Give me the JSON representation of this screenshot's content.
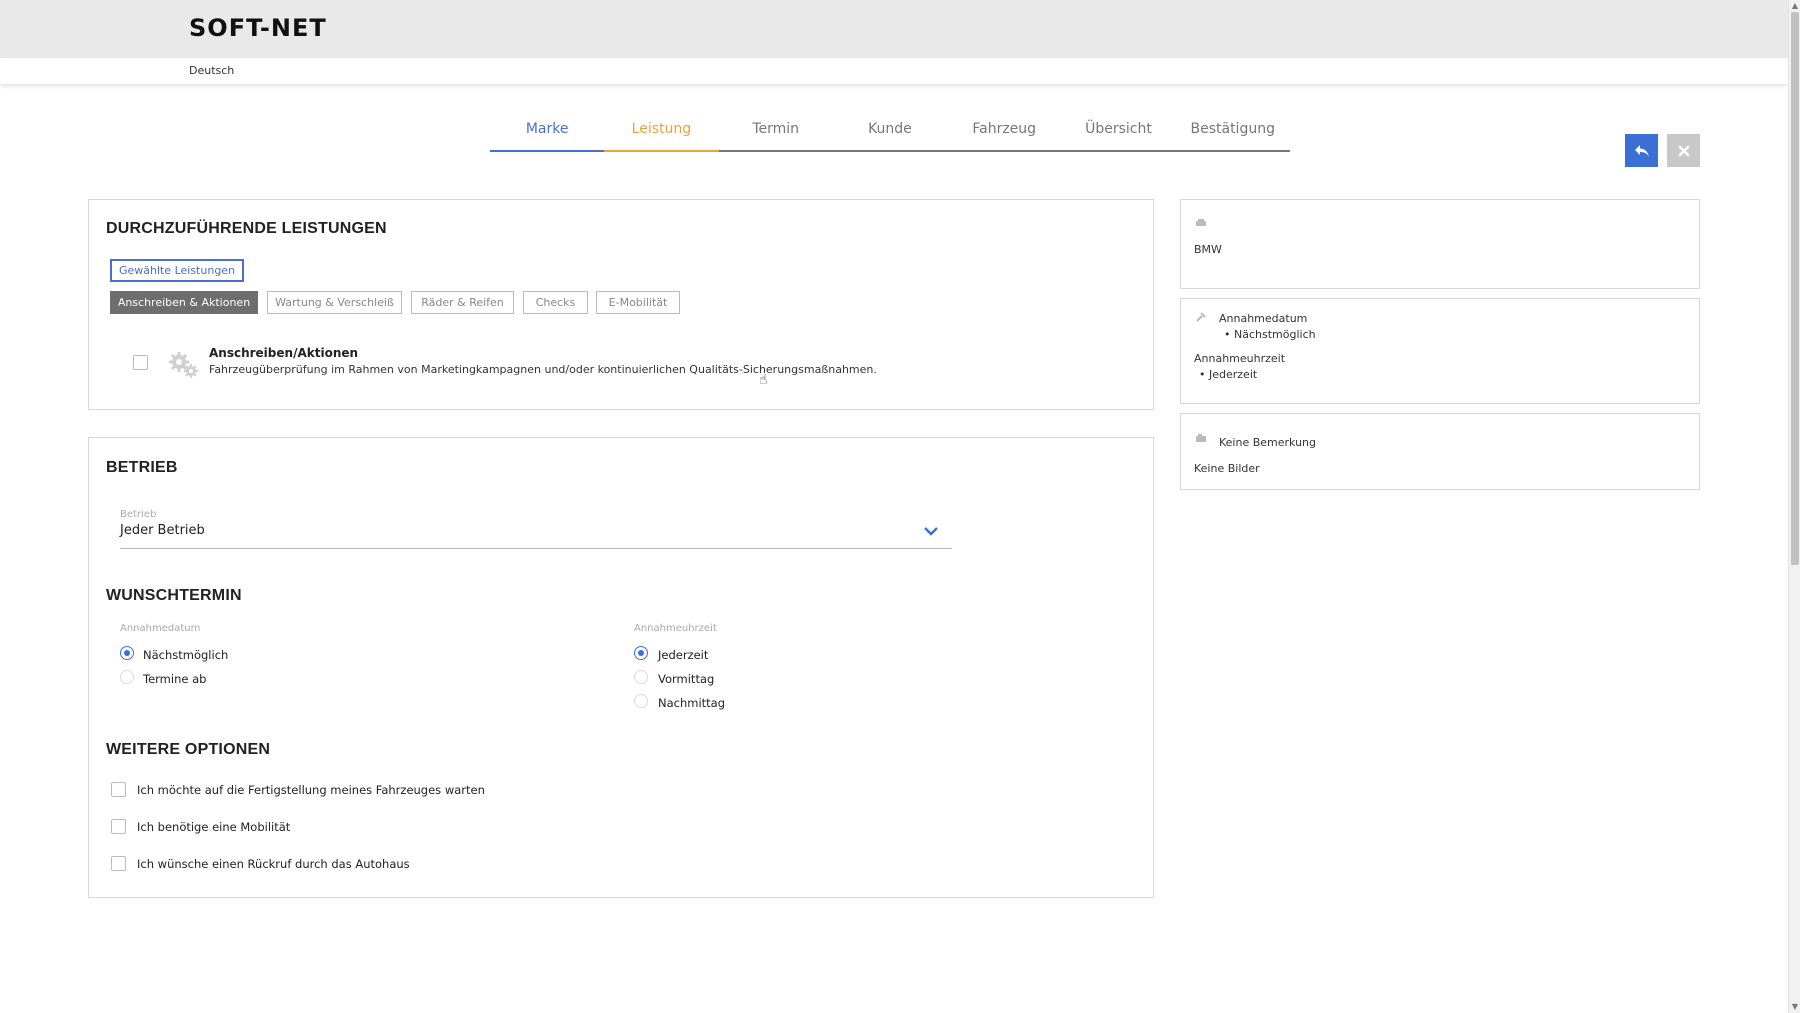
{
  "header": {
    "logo": "SOFT-NET",
    "language": "Deutsch"
  },
  "steps": [
    {
      "label": "Marke",
      "state": "done"
    },
    {
      "label": "Leistung",
      "state": "active"
    },
    {
      "label": "Termin",
      "state": "pending"
    },
    {
      "label": "Kunde",
      "state": "pending"
    },
    {
      "label": "Fahrzeug",
      "state": "pending"
    },
    {
      "label": "Übersicht",
      "state": "pending"
    },
    {
      "label": "Bestätigung",
      "state": "pending"
    }
  ],
  "actions": {
    "back_icon": "undo-arrow-icon",
    "close_icon": "close-icon",
    "back_color": "#3c6fd6",
    "close_color": "#c8c8c8"
  },
  "services": {
    "title": "DURCHZUFÜHRENDE LEISTUNGEN",
    "selected_button": "Gewählte Leistungen",
    "categories": [
      {
        "label": "Anschreiben & Aktionen",
        "selected": true
      },
      {
        "label": "Wartung & Verschleiß",
        "selected": false
      },
      {
        "label": "Räder & Reifen",
        "selected": false
      },
      {
        "label": "Checks",
        "selected": false
      },
      {
        "label": "E-Mobilität",
        "selected": false
      }
    ],
    "item": {
      "title": "Anschreiben/Aktionen",
      "description": "Fahrzeugüberprüfung im Rahmen von Marketingkampagnen und/oder kontinuierlichen Qualitäts-Sicherungsmaßnahmen.",
      "icon": "gears-icon",
      "checked": false
    }
  },
  "betrieb": {
    "title": "BETRIEB",
    "field_label": "Betrieb",
    "field_value": "Jeder Betrieb"
  },
  "wunschtermin": {
    "title": "WUNSCHTERMIN",
    "date_label": "Annahmedatum",
    "date_options": [
      "Nächstmöglich",
      "Termine ab"
    ],
    "date_selected": 0,
    "time_label": "Annahmeuhrzeit",
    "time_options": [
      "Jederzeit",
      "Vormittag",
      "Nachmittag"
    ],
    "time_selected": 0
  },
  "weitere": {
    "title": "WEITERE OPTIONEN",
    "options": [
      "Ich möchte auf die Fertigstellung meines Fahrzeuges warten",
      "Ich benötige eine Mobilität",
      "Ich wünsche einen Rückruf durch das Autohaus"
    ]
  },
  "summary": {
    "brand": "BMW",
    "date_label": "Annahmedatum",
    "date_value": "Nächstmöglich",
    "time_label": "Annahmeuhrzeit",
    "time_value": "Jederzeit",
    "note": "Keine Bemerkung",
    "images": "Keine Bilder"
  }
}
